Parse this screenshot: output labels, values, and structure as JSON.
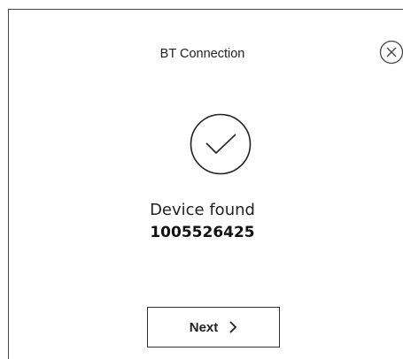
{
  "dialog": {
    "title": "BT Connection",
    "close_icon": "close-circle-icon"
  },
  "status": {
    "icon": "check-circle-icon",
    "message": "Device found",
    "serial": "1005526425"
  },
  "actions": {
    "next_label": "Next",
    "next_icon": "chevron-right-icon"
  }
}
